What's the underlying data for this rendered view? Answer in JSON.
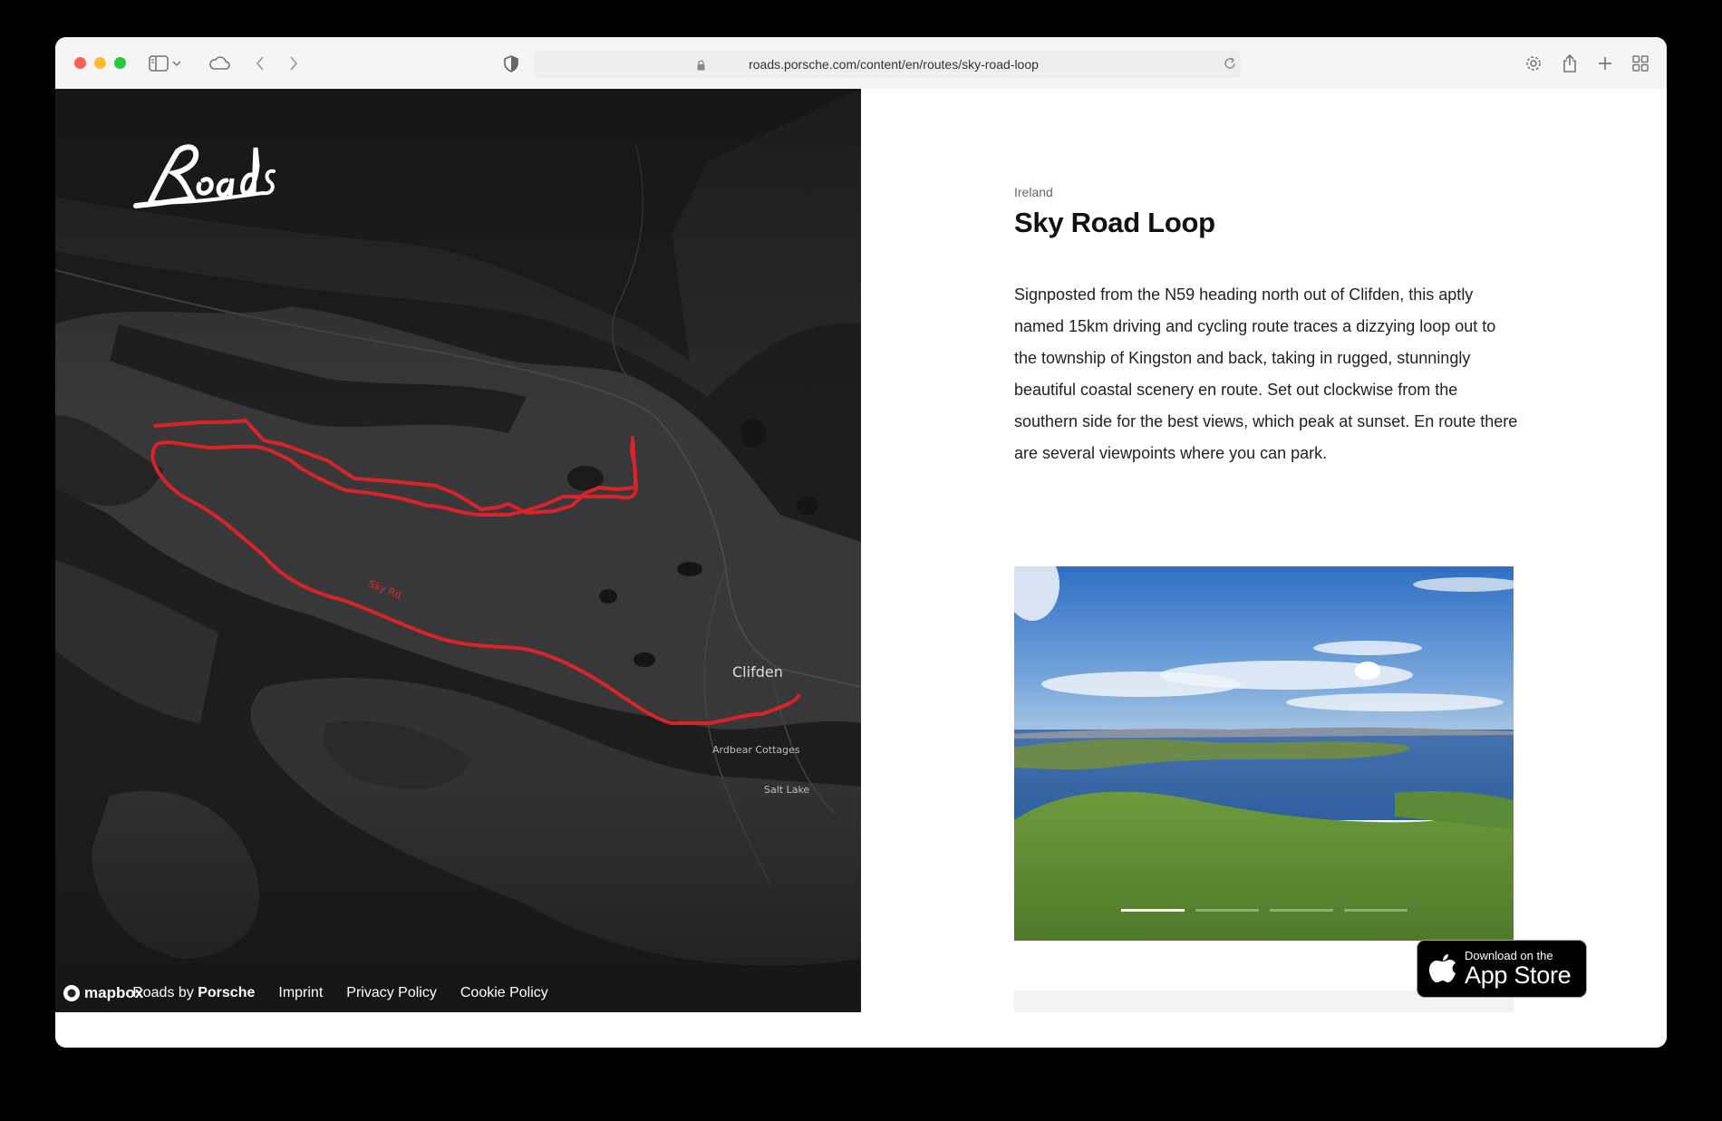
{
  "browser": {
    "url": "roads.porsche.com/content/en/routes/sky-road-loop",
    "icons": [
      "sidebar-icon",
      "chevron-down-icon",
      "cloud-icon",
      "back-icon",
      "forward-icon",
      "shield-icon",
      "lock-icon",
      "reload-icon",
      "gear-icon",
      "share-icon",
      "plus-icon",
      "tabs-grid-icon"
    ]
  },
  "map": {
    "logo_text": "Roads",
    "route_label": "Sky Rd",
    "places": {
      "clifden": "Clifden",
      "ardbear": "Ardbear Cottages",
      "salt_lake": "Salt Lake"
    },
    "route_color": "#e0242b",
    "attribution": "mapbox"
  },
  "footer": {
    "brand_prefix": "Roads by",
    "brand_name": "Porsche",
    "links": [
      "Imprint",
      "Privacy Policy",
      "Cookie Policy"
    ]
  },
  "route": {
    "country": "Ireland",
    "title": "Sky Road Loop",
    "description": "Signposted from the N59 heading north out of Clifden, this aptly named 15km driving and cycling route traces a dizzying loop out to the township of Kingston and back, taking in rugged, stunningly beautiful coastal scenery en route. Set out clockwise from the southern side for the best views, which peak at sunset. En route there are several viewpoints where you can park."
  },
  "gallery": {
    "slides_total": 4,
    "active_slide": 1
  },
  "app_store": {
    "small": "Download on the",
    "big": "App Store"
  }
}
